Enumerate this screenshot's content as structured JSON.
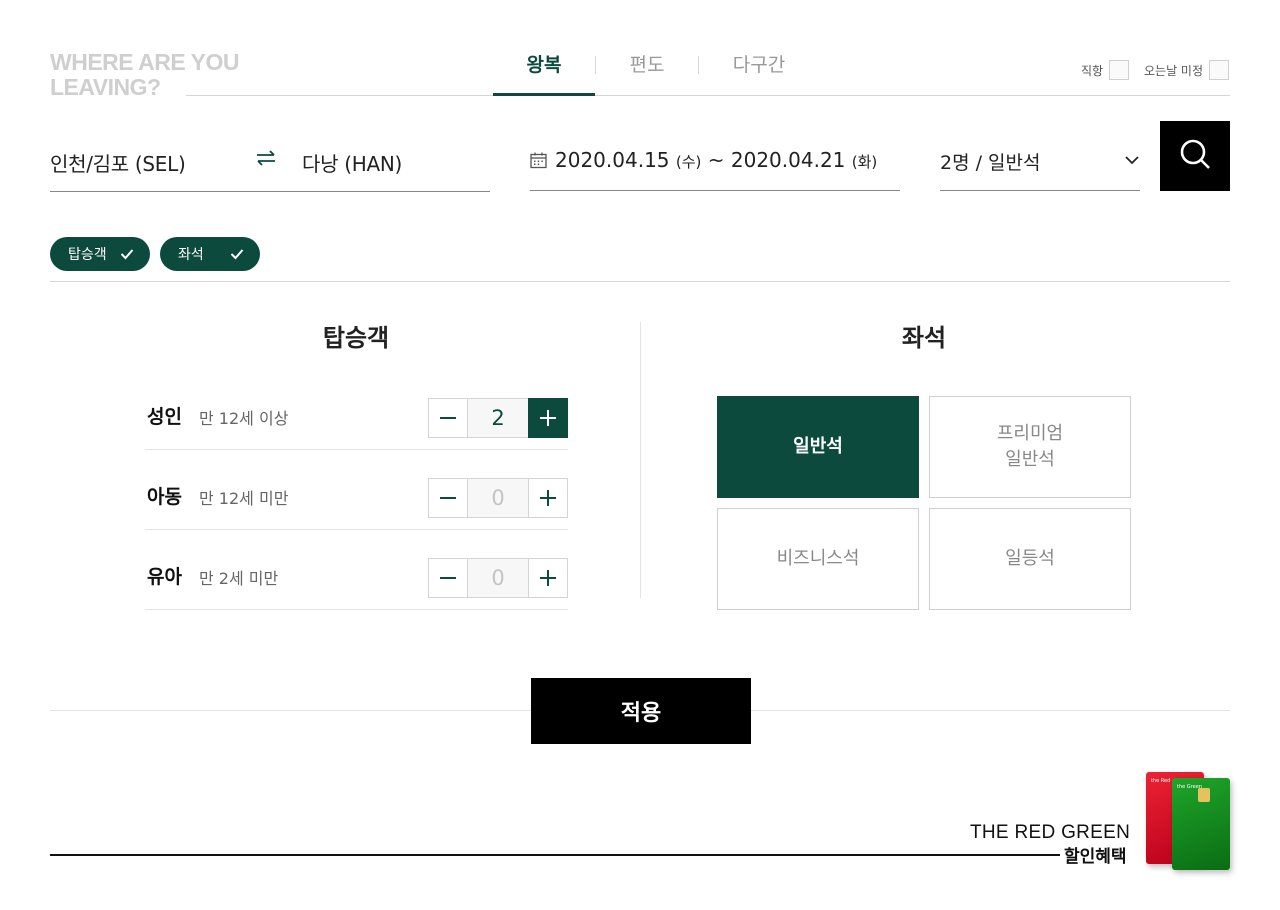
{
  "header": {
    "heading_line1": "WHERE ARE YOU",
    "heading_line2": "LEAVING?",
    "tabs": [
      {
        "label": "왕복",
        "active": true
      },
      {
        "label": "편도",
        "active": false
      },
      {
        "label": "다구간",
        "active": false
      }
    ],
    "options": [
      {
        "label": "직항",
        "checked": false
      },
      {
        "label": "오는날 미정",
        "checked": false
      }
    ]
  },
  "search": {
    "origin": "인천/김포 (SEL)",
    "destination": "다낭 (HAN)",
    "depart_date": "2020.04.15",
    "depart_day": "(수)",
    "separator": "~",
    "return_date": "2020.04.21",
    "return_day": "(화)",
    "passenger_summary": "2명 / 일반석"
  },
  "chips": [
    {
      "label": "탑승객"
    },
    {
      "label": "좌석"
    }
  ],
  "passengers": {
    "title": "탑승객",
    "rows": [
      {
        "label": "성인",
        "sub": "만 12세 이상",
        "count": "2"
      },
      {
        "label": "아동",
        "sub": "만 12세 미만",
        "count": "0"
      },
      {
        "label": "유아",
        "sub": "만 2세 미만",
        "count": "0"
      }
    ]
  },
  "seats": {
    "title": "좌석",
    "options": [
      {
        "label": "일반석",
        "selected": true
      },
      {
        "label": "프리미엄\n일반석",
        "selected": false
      },
      {
        "label": "비즈니스석",
        "selected": false
      },
      {
        "label": "일등석",
        "selected": false
      }
    ]
  },
  "apply_label": "적용",
  "banner": {
    "title": "THE RED GREEN",
    "subtitle": "할인혜택",
    "card_red_text": "the Red",
    "card_green_text": "the Green"
  },
  "colors": {
    "accent": "#0d4a3e",
    "black": "#000000"
  }
}
